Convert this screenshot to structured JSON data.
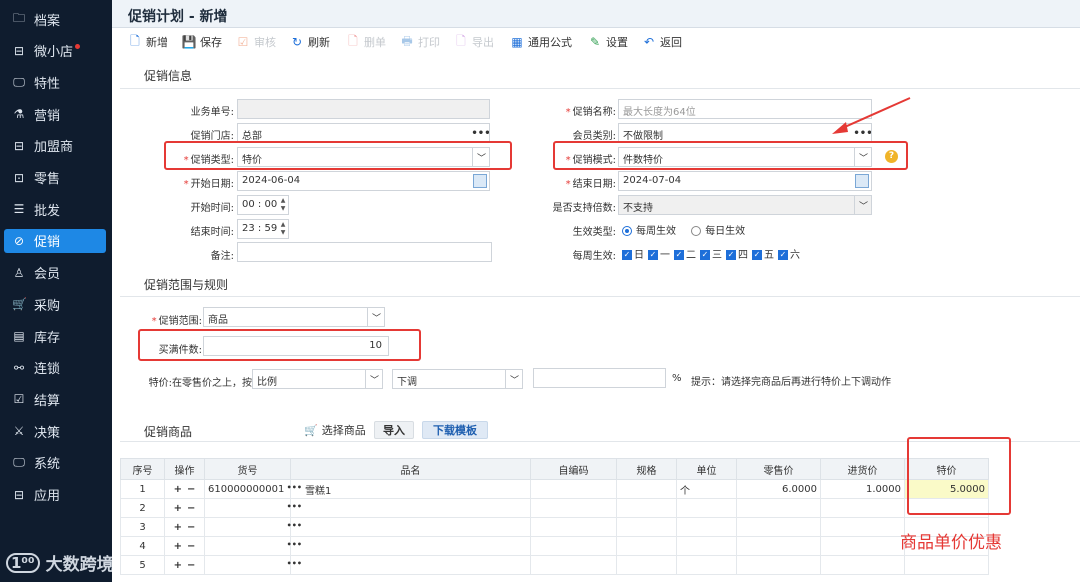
{
  "sidebar": {
    "items": [
      {
        "label": "档案",
        "icon": "folder-icon"
      },
      {
        "label": "微小店",
        "icon": "shop-icon",
        "dot": true
      },
      {
        "label": "特性",
        "icon": "monitor-icon"
      },
      {
        "label": "营销",
        "icon": "gift-icon"
      },
      {
        "label": "加盟商",
        "icon": "store-icon"
      },
      {
        "label": "零售",
        "icon": "bag-icon"
      },
      {
        "label": "批发",
        "icon": "list-icon"
      },
      {
        "label": "促销",
        "icon": "promo-icon",
        "active": true
      },
      {
        "label": "会员",
        "icon": "user-icon"
      },
      {
        "label": "采购",
        "icon": "cart-icon"
      },
      {
        "label": "库存",
        "icon": "warehouse-icon"
      },
      {
        "label": "连锁",
        "icon": "link-icon"
      },
      {
        "label": "结算",
        "icon": "settle-icon"
      },
      {
        "label": "决策",
        "icon": "decision-icon"
      },
      {
        "label": "系统",
        "icon": "system-icon"
      },
      {
        "label": "应用",
        "icon": "app-icon"
      }
    ]
  },
  "watermark": {
    "logo": "1⁰⁰",
    "text": "大数跨境"
  },
  "page_title": "促销计划 - 新增",
  "toolbar": [
    {
      "label": "新增",
      "icon": "new-doc-icon",
      "disabled": false,
      "color": "#1e6fd9",
      "glyph": "🗋"
    },
    {
      "label": "保存",
      "icon": "save-icon",
      "disabled": false,
      "color": "#2e9e4f",
      "glyph": "💾"
    },
    {
      "label": "审核",
      "icon": "approve-icon",
      "disabled": true,
      "color": "#f3b8a0",
      "glyph": "☑"
    },
    {
      "label": "刷新",
      "icon": "refresh-icon",
      "disabled": false,
      "color": "#1e6fd9",
      "glyph": "↻"
    },
    {
      "label": "删单",
      "icon": "delete-doc-icon",
      "disabled": true,
      "color": "#f0a0a0",
      "glyph": "🗋"
    },
    {
      "label": "打印",
      "icon": "print-icon",
      "disabled": true,
      "color": "#a8c8e8",
      "glyph": "🖶"
    },
    {
      "label": "导出",
      "icon": "export-icon",
      "disabled": true,
      "color": "#d8b0e8",
      "glyph": "🗋"
    },
    {
      "label": "通用公式",
      "icon": "formula-icon",
      "disabled": false,
      "color": "#1e6fd9",
      "glyph": "▦"
    },
    {
      "label": "设置",
      "icon": "settings-icon",
      "disabled": false,
      "color": "#2e9e4f",
      "glyph": "✎"
    },
    {
      "label": "返回",
      "icon": "back-icon",
      "disabled": false,
      "color": "#1e6fd9",
      "glyph": "↶"
    }
  ],
  "info": {
    "section_title": "促销信息",
    "biz_no": {
      "label": "业务单号:",
      "value": ""
    },
    "store": {
      "label": "促销门店:",
      "value": "总部"
    },
    "promo_type": {
      "label": "促销类型:",
      "value": "特价"
    },
    "start_date": {
      "label": "开始日期:",
      "value": "2024-06-04"
    },
    "start_time": {
      "label": "开始时间:",
      "value": "00 : 00"
    },
    "end_time": {
      "label": "结束时间:",
      "value": "23 : 59"
    },
    "remark": {
      "label": "备注:",
      "value": ""
    },
    "promo_name": {
      "label": "促销名称:",
      "placeholder": "最大长度为64位"
    },
    "member_type": {
      "label": "会员类别:",
      "value": "不做限制"
    },
    "promo_mode": {
      "label": "促销模式:",
      "value": "件数特价"
    },
    "end_date": {
      "label": "结束日期:",
      "value": "2024-07-04"
    },
    "multiple": {
      "label": "是否支持倍数:",
      "value": "不支持"
    },
    "effect_type": {
      "label": "生效类型:",
      "options": [
        "每周生效",
        "每日生效"
      ],
      "selected": 0
    },
    "weekly": {
      "label": "每周生效:",
      "days": [
        "日",
        "一",
        "二",
        "三",
        "四",
        "五",
        "六"
      ]
    }
  },
  "scope": {
    "section_title": "促销范围与规则",
    "range": {
      "label": "促销范围:",
      "value": "商品"
    },
    "qty": {
      "label": "买满件数:",
      "value": "10"
    },
    "special": {
      "label": "特价:在零售价之上，按",
      "mode": "比例",
      "dir": "下调",
      "value": "",
      "unit": "%",
      "hint": "提示：请选择完商品后再进行特价上下调动作"
    }
  },
  "goods": {
    "section_title": "促销商品",
    "select_label": "选择商品",
    "import_label": "导入",
    "download_label": "下载模板",
    "columns": [
      "序号",
      "操作",
      "货号",
      "品名",
      "自编码",
      "规格",
      "单位",
      "零售价",
      "进货价",
      "特价"
    ],
    "rows": [
      {
        "no": "1",
        "code": "610000000001",
        "name": "雪糕1",
        "unit": "个",
        "retail": "6.0000",
        "cost": "1.0000",
        "special": "5.0000"
      },
      {
        "no": "2",
        "code": "",
        "name": "",
        "unit": "",
        "retail": "",
        "cost": "",
        "special": ""
      },
      {
        "no": "3",
        "code": "",
        "name": "",
        "unit": "",
        "retail": "",
        "cost": "",
        "special": ""
      },
      {
        "no": "4",
        "code": "",
        "name": "",
        "unit": "",
        "retail": "",
        "cost": "",
        "special": ""
      },
      {
        "no": "5",
        "code": "",
        "name": "",
        "unit": "",
        "retail": "",
        "cost": "",
        "special": ""
      }
    ]
  },
  "annotation": "商品单价优惠",
  "colors": {
    "accent": "#1e88e5",
    "highlight": "#e53935"
  }
}
